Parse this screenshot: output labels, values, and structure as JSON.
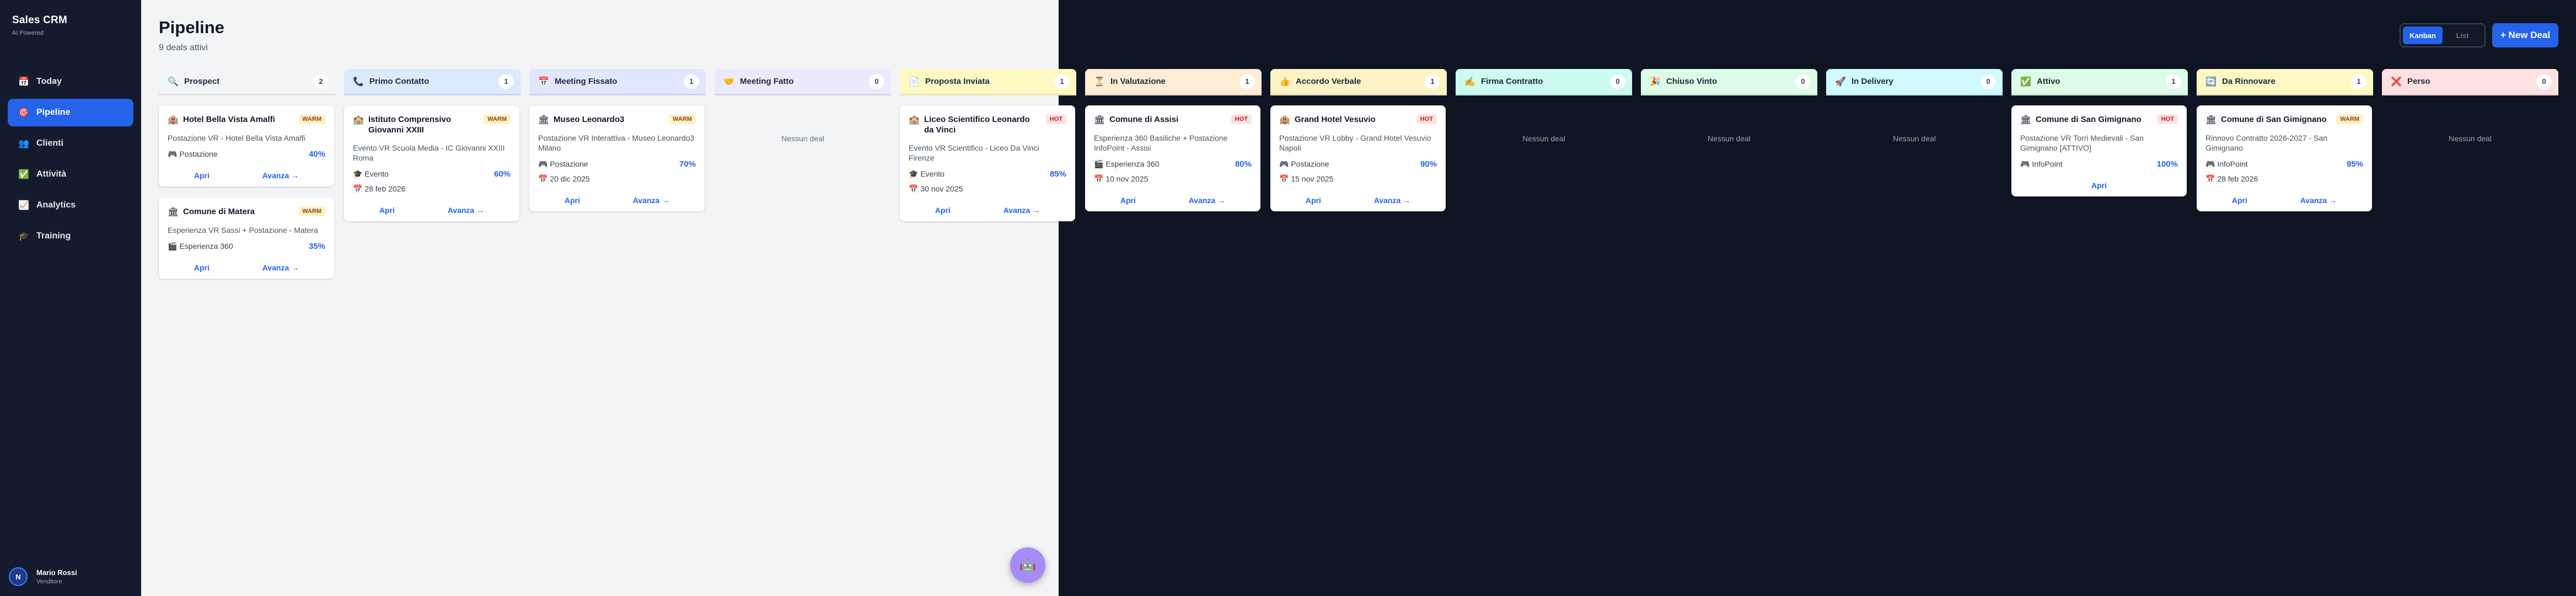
{
  "app": {
    "title": "Sales CRM",
    "subtitle": "AI Powered"
  },
  "sidebar": {
    "items": [
      {
        "label": "Today",
        "icon": "calendar-icon",
        "glyph": "📅"
      },
      {
        "label": "Pipeline",
        "icon": "target-icon",
        "glyph": "🎯"
      },
      {
        "label": "Clienti",
        "icon": "people-icon",
        "glyph": "👥"
      },
      {
        "label": "Attività",
        "icon": "check-icon",
        "glyph": "✅"
      },
      {
        "label": "Analytics",
        "icon": "chart-icon",
        "glyph": "📈"
      },
      {
        "label": "Training",
        "icon": "graduation-icon",
        "glyph": "🎓"
      }
    ],
    "active_index": 1
  },
  "user": {
    "initials": "N",
    "name": "Mario Rossi",
    "role": "Venditore"
  },
  "page": {
    "title": "Pipeline",
    "subtitle": "9 deals attivi"
  },
  "toolbar": {
    "kanban_label": "Kanban",
    "list_label": "List",
    "new_deal_label": "+ New Deal"
  },
  "empty_text": "Nessun deal",
  "card_actions": {
    "open": "Apri",
    "advance": "Avanza →"
  },
  "columns": [
    {
      "key": "prospect",
      "title": "Prospect",
      "count": "2",
      "icon": "magnifier-icon",
      "glyph": "🔍",
      "color": "#f3f4f6",
      "cards": [
        {
          "title": "Hotel Bella Vista Amalfi",
          "badge": "WARM",
          "desc": "Postazione VR - Hotel Bella Vista Amalfi",
          "product": "🎮 Postazione",
          "probability": "40%",
          "date": "",
          "icon": "building-icon",
          "glyph": "🏨"
        },
        {
          "title": "Comune di Matera",
          "badge": "WARM",
          "desc": "Esperienza VR Sassi + Postazione - Matera",
          "product": "🎬 Esperienza 360",
          "probability": "35%",
          "date": "",
          "icon": "building-icon",
          "glyph": "🏛"
        }
      ]
    },
    {
      "key": "primo-contatto",
      "title": "Primo Contatto",
      "count": "1",
      "icon": "phone-icon",
      "glyph": "📞",
      "color": "#dbeafe",
      "cards": [
        {
          "title": "Istituto Comprensivo Giovanni XXIII",
          "badge": "WARM",
          "desc": "Evento VR Scuola Media - IC Giovanni XXIII Roma",
          "product": "🎓 Evento",
          "probability": "60%",
          "date": "📅 28 feb 2026",
          "icon": "building-icon",
          "glyph": "🏫"
        }
      ]
    },
    {
      "key": "meeting-fissato",
      "title": "Meeting Fissato",
      "count": "1",
      "icon": "calendar-icon",
      "glyph": "📅",
      "color": "#e0e7ff",
      "cards": [
        {
          "title": "Museo Leonardo3",
          "badge": "WARM",
          "desc": "Postazione VR Interattiva - Museo Leonardo3 Milano",
          "product": "🎮 Postazione",
          "probability": "70%",
          "date": "📅 20 dic 2025",
          "icon": "building-icon",
          "glyph": "🏛"
        }
      ]
    },
    {
      "key": "meeting-fatto",
      "title": "Meeting Fatto",
      "count": "0",
      "icon": "handshake-icon",
      "glyph": "🤝",
      "color": "#ede9fe",
      "cards": []
    },
    {
      "key": "proposta-inviata",
      "title": "Proposta Inviata",
      "count": "1",
      "icon": "document-icon",
      "glyph": "📄",
      "color": "#fef9c3",
      "cards": [
        {
          "title": "Liceo Scientifico Leonardo da Vinci",
          "badge": "HOT",
          "desc": "Evento VR Scientifico - Liceo Da Vinci Firenze",
          "product": "🎓 Evento",
          "probability": "85%",
          "date": "📅 30 nov 2025",
          "icon": "building-icon",
          "glyph": "🏫"
        }
      ]
    },
    {
      "key": "in-valutazione",
      "title": "In Valutazione",
      "count": "1",
      "icon": "hourglass-icon",
      "glyph": "⏳",
      "color": "#ffedd5",
      "cards": [
        {
          "title": "Comune di Assisi",
          "badge": "HOT",
          "desc": "Esperienza 360 Basiliche + Postazione InfoPoint - Assisi",
          "product": "🎬 Esperienza 360",
          "probability": "80%",
          "date": "📅 10 nov 2025",
          "icon": "building-icon",
          "glyph": "🏛"
        }
      ]
    },
    {
      "key": "accordo-verbale",
      "title": "Accordo Verbale",
      "count": "1",
      "icon": "thumbs-up-icon",
      "glyph": "👍",
      "color": "#fef3c7",
      "cards": [
        {
          "title": "Grand Hotel Vesuvio",
          "badge": "HOT",
          "desc": "Postazione VR Lobby - Grand Hotel Vesuvio Napoli",
          "product": "🎮 Postazione",
          "probability": "90%",
          "date": "📅 15 nov 2025",
          "icon": "building-icon",
          "glyph": "🏨"
        }
      ]
    },
    {
      "key": "firma-contratto",
      "title": "Firma Contratto",
      "count": "0",
      "icon": "pen-icon",
      "glyph": "✍",
      "color": "#ccfbf1",
      "cards": []
    },
    {
      "key": "chiuso-vinto",
      "title": "Chiuso Vinto",
      "count": "0",
      "icon": "party-icon",
      "glyph": "🎉",
      "color": "#dcfce7",
      "cards": []
    },
    {
      "key": "in-delivery",
      "title": "In Delivery",
      "count": "0",
      "icon": "rocket-icon",
      "glyph": "🚀",
      "color": "#cffafe",
      "cards": []
    },
    {
      "key": "attivo",
      "title": "Attivo",
      "count": "1",
      "icon": "check-icon",
      "glyph": "✅",
      "color": "#dcfce7",
      "cards": [
        {
          "title": "Comune di San Gimignano",
          "badge": "HOT",
          "desc": "Postazione VR Torri Medievali - San Gimignano [ATTIVO]",
          "product": "🎮 InfoPoint",
          "probability": "100%",
          "date": "",
          "icon": "building-icon",
          "glyph": "🏛"
        }
      ]
    },
    {
      "key": "da-rinnovare",
      "title": "Da Rinnovare",
      "count": "1",
      "icon": "refresh-icon",
      "glyph": "🔄",
      "color": "#fef9c3",
      "cards": [
        {
          "title": "Comune di San Gimignano",
          "badge": "WARM",
          "desc": "Rinnovo Contratto 2026-2027 - San Gimignano",
          "product": "🎮 InfoPoint",
          "probability": "95%",
          "date": "📅 28 feb 2026",
          "icon": "building-icon",
          "glyph": "🏛"
        }
      ]
    },
    {
      "key": "perso",
      "title": "Perso",
      "count": "0",
      "icon": "cross-icon",
      "glyph": "❌",
      "color": "#fee2e2",
      "cards": []
    }
  ],
  "fab": {
    "glyph": "🤖",
    "icon": "robot-icon"
  }
}
